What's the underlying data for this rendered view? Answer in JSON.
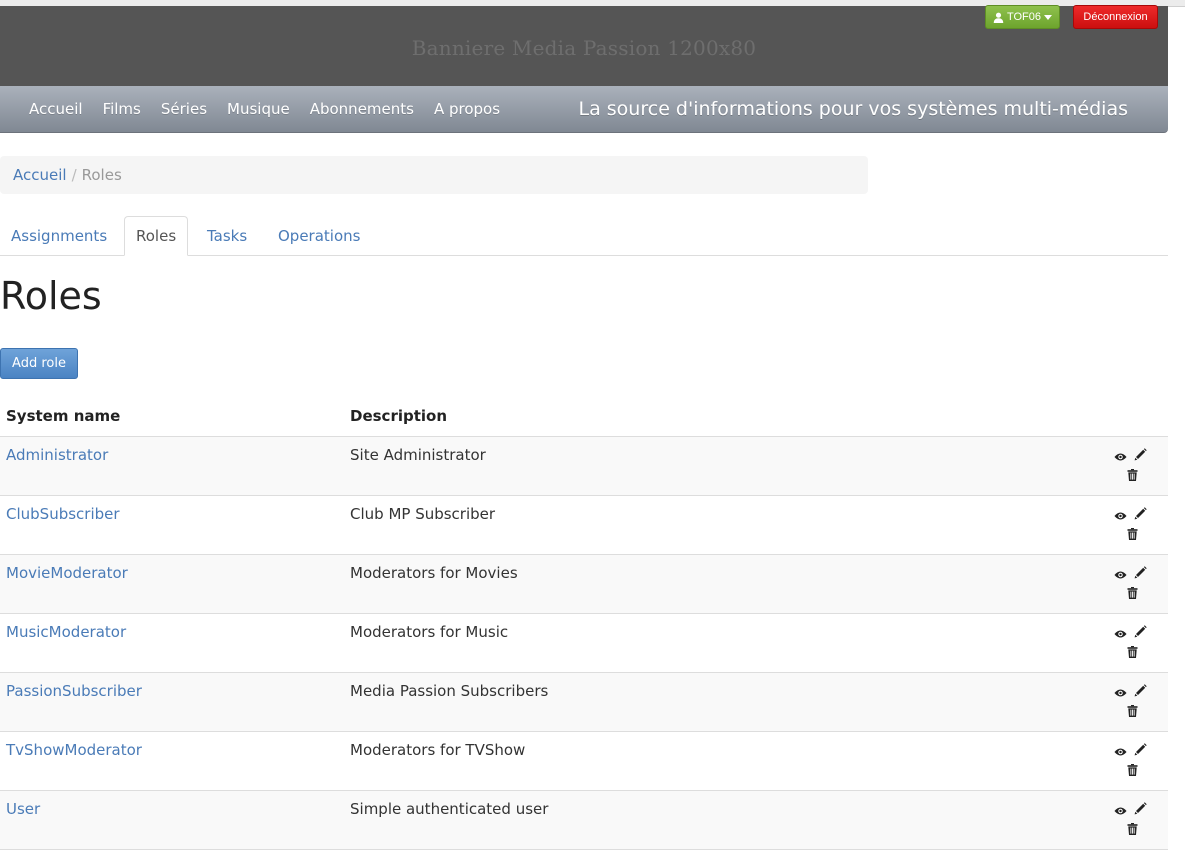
{
  "banner": {
    "title": "Banniere Media Passion 1200x80"
  },
  "user_menu": {
    "username": "TOF06",
    "icon": "user-icon",
    "caret_icon": "caret-down-icon"
  },
  "logout": {
    "label": "Déconnexion"
  },
  "nav": {
    "items": [
      {
        "label": "Accueil"
      },
      {
        "label": "Films"
      },
      {
        "label": "Séries"
      },
      {
        "label": "Musique"
      },
      {
        "label": "Abonnements"
      },
      {
        "label": "A propos"
      }
    ],
    "tagline": "La source d'informations pour vos systèmes multi-médias"
  },
  "breadcrumb": {
    "home": "Accueil",
    "separator": "/",
    "current": "Roles"
  },
  "tabs": [
    {
      "label": "Assignments",
      "active": false
    },
    {
      "label": "Roles",
      "active": true
    },
    {
      "label": "Tasks",
      "active": false
    },
    {
      "label": "Operations",
      "active": false
    }
  ],
  "page": {
    "title": "Roles",
    "add_button": "Add role"
  },
  "table": {
    "headers": {
      "name": "System name",
      "description": "Description"
    },
    "action_icons": [
      "eye-icon",
      "pencil-icon",
      "trash-icon"
    ],
    "rows": [
      {
        "name": "Administrator",
        "description": "Site Administrator"
      },
      {
        "name": "ClubSubscriber",
        "description": "Club MP Subscriber"
      },
      {
        "name": "MovieModerator",
        "description": "Moderators for Movies"
      },
      {
        "name": "MusicModerator",
        "description": "Moderators for Music"
      },
      {
        "name": "PassionSubscriber",
        "description": "Media Passion Subscribers"
      },
      {
        "name": "TvShowModerator",
        "description": "Moderators for TVShow"
      },
      {
        "name": "User",
        "description": "Simple authenticated user"
      }
    ]
  },
  "colors": {
    "banner_bg": "#555555",
    "link": "#4a7bb7",
    "user_button": "#7ab03a",
    "logout_button": "#dd1c1c",
    "primary_button": "#5a93cf"
  }
}
